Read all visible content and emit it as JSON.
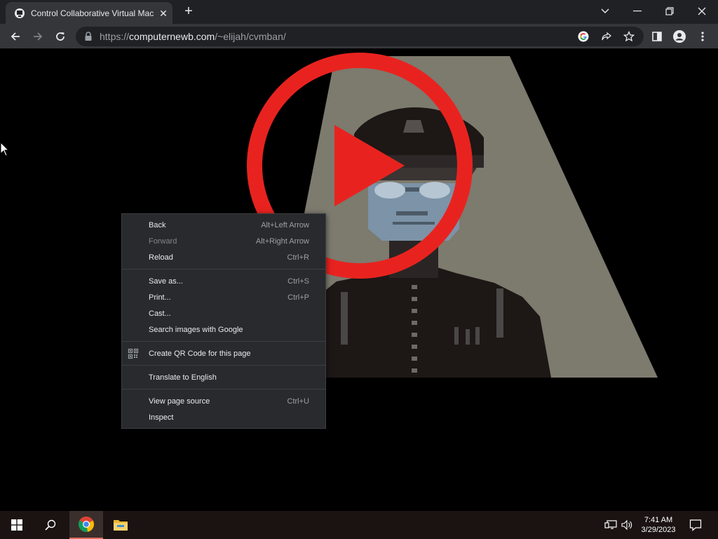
{
  "tab": {
    "title": "Control Collaborative Virtual Machin"
  },
  "toolbar": {
    "url_prefix": "https://",
    "url_host": "computernewb.com",
    "url_path": "/~elijah/cvmban/"
  },
  "context_menu": {
    "items": [
      {
        "label": "Back",
        "shortcut": "Alt+Left Arrow"
      },
      {
        "label": "Forward",
        "shortcut": "Alt+Right Arrow"
      },
      {
        "label": "Reload",
        "shortcut": "Ctrl+R"
      },
      {
        "label": "Save as...",
        "shortcut": "Ctrl+S"
      },
      {
        "label": "Print...",
        "shortcut": "Ctrl+P"
      },
      {
        "label": "Cast..."
      },
      {
        "label": "Search images with Google"
      },
      {
        "label": "Create QR Code for this page"
      },
      {
        "label": "Translate to English"
      },
      {
        "label": "View page source",
        "shortcut": "Ctrl+U"
      },
      {
        "label": "Inspect"
      }
    ]
  },
  "taskbar": {
    "time": "7:41 AM",
    "date": "3/29/2023"
  },
  "colors": {
    "play_red": "#e8231f",
    "figure_face": "#7c93a8",
    "background_beige": "#7d7a6e"
  }
}
